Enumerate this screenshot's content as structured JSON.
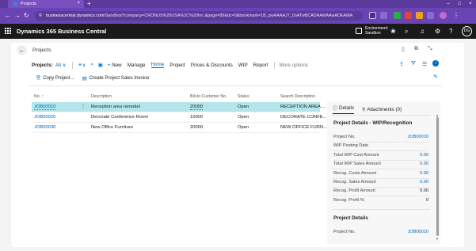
{
  "browser": {
    "tab_title": "Projects",
    "url_host": "businesscentral.dynamics.com",
    "url_path": "/Sandbox?company=CRONUS%20USA%2C%20Inc.&page=89&dc=0&bookmark=1B_pwAAAAJ7_0oATwBCADAAMAAwADEAMA",
    "new_tab": "+",
    "back": "←",
    "forward": "→",
    "reload": "↻"
  },
  "app": {
    "name": "Dynamics 365 Business Central",
    "environment_label": "Environment:",
    "environment_value": "Sandbox",
    "avatar_initials": "DG"
  },
  "page": {
    "caption": "Projects",
    "list_title": "Projects:",
    "view_filter": "All",
    "actions": {
      "new": "New",
      "manage": "Manage",
      "home": "Home",
      "project": "Project",
      "prices_discounts": "Prices & Discounts",
      "wip": "WIP",
      "report": "Report",
      "more_options": "More options"
    },
    "subactions": {
      "copy_project": "Copy Project...",
      "create_invoice": "Create Project Sales Invoice"
    }
  },
  "table": {
    "headers": {
      "no": "No. ↑",
      "description": "Description",
      "bill_to": "Bill-to Customer No.",
      "status": "Status",
      "search_description": "Search Description"
    },
    "rows": [
      {
        "no": "JOB00010",
        "description": "Reception area remodel",
        "bill_to": "20000",
        "status": "Open",
        "search": "RECEPTION AREA ..."
      },
      {
        "no": "JOB00020",
        "description": "Decorate Conference Room",
        "bill_to": "10000",
        "status": "Open",
        "search": "DECORATE CONFE..."
      },
      {
        "no": "JOB00030",
        "description": "New Office Furniture",
        "bill_to": "20000",
        "status": "Open",
        "search": "NEW OFFICE FURN..."
      }
    ]
  },
  "factbox": {
    "tab_details": "Details",
    "tab_attachments": "Attachments (0)",
    "section1_title": "Project Details - WIP/Recognition",
    "section1_rows": [
      {
        "label": "Project No.",
        "value": "JOB00010"
      },
      {
        "label": "WIP Posting Date",
        "value": ""
      },
      {
        "label": "Total WIP Cost Amount",
        "value": "0.00"
      },
      {
        "label": "Total WIP Sales Amount",
        "value": "0.00"
      },
      {
        "label": "Recog. Costs Amount",
        "value": "0.00"
      },
      {
        "label": "Recog. Sales Amount",
        "value": "0.00"
      },
      {
        "label": "Recog. Profit Amount",
        "value": "0.00"
      },
      {
        "label": "Recog. Profit %",
        "value": "0"
      }
    ],
    "section2_title": "Project Details",
    "section2_rows": [
      {
        "label": "Project No.",
        "value": "JOB00010"
      }
    ]
  }
}
